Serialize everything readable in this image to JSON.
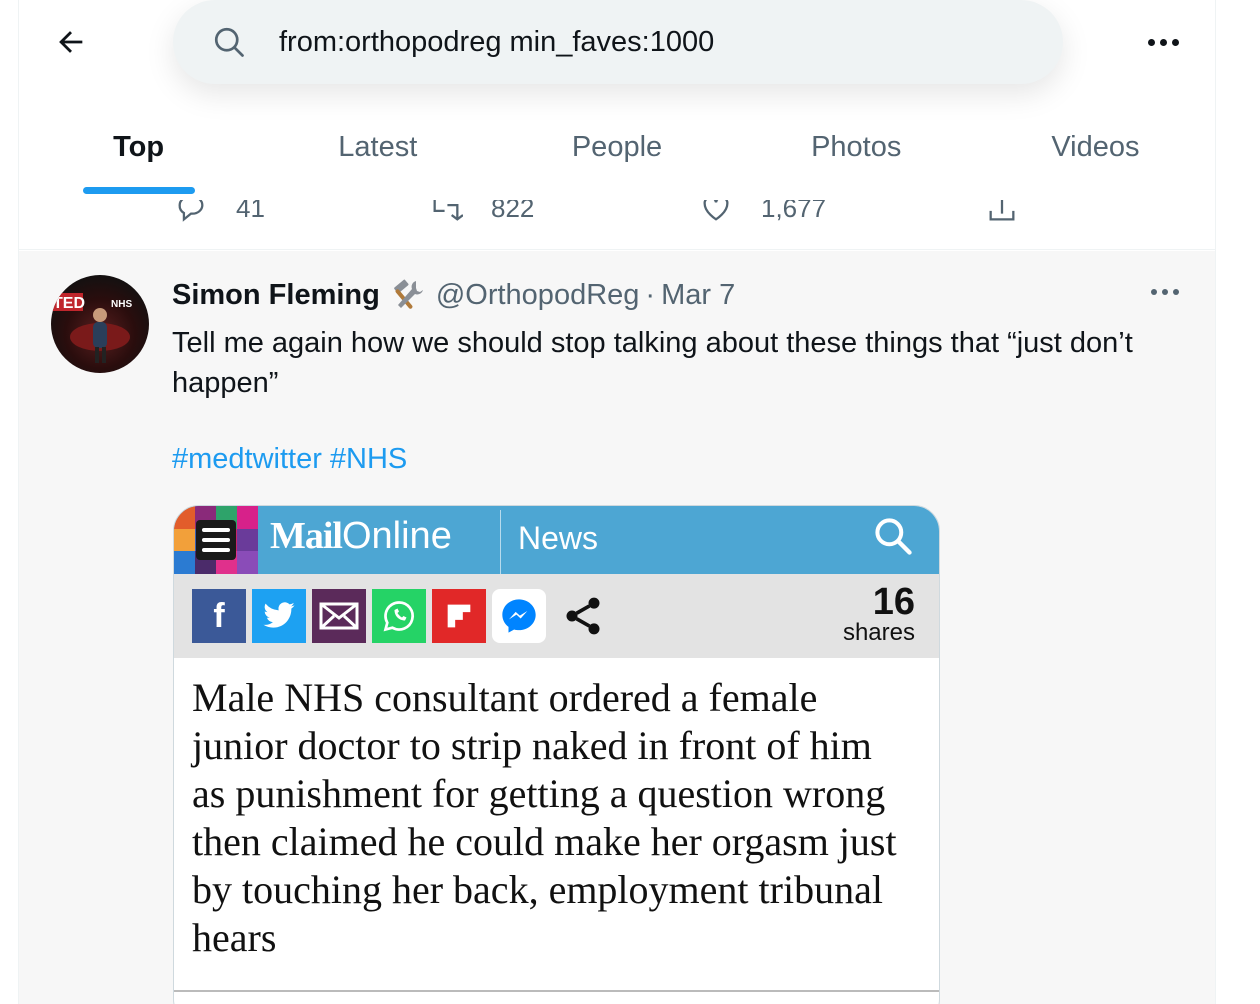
{
  "search": {
    "query": "from:orthopodreg min_faves:1000"
  },
  "tabs": [
    {
      "label": "Top"
    },
    {
      "label": "Latest"
    },
    {
      "label": "People"
    },
    {
      "label": "Photos"
    },
    {
      "label": "Videos"
    }
  ],
  "prev_tweet": {
    "replies": "41",
    "retweets": "822",
    "likes": "1,677"
  },
  "tweet": {
    "display_name": "Simon Fleming",
    "handle": "@OrthopodReg",
    "separator": "·",
    "date": "Mar 7",
    "text": "Tell me again how we should stop talking about these things that “just don’t happen”",
    "hashtags": [
      "#medtwitter",
      "#NHS"
    ]
  },
  "media": {
    "brand_main": "Mail",
    "brand_suffix": "Online",
    "section": "News",
    "shares_count": "16",
    "shares_label": "shares",
    "headline": "Male NHS consultant ordered a female junior doctor to strip naked in front of him as punishment for getting a question wrong then claimed he could make her orgasm just by touching her back, employment tribunal hears",
    "avatar_text": "NHS",
    "avatar_brand": "TED"
  },
  "colors": {
    "accent": "#1d9bf0",
    "mail_blue": "#4da6d3",
    "facebook": "#3b5998",
    "twitter": "#1da1f2",
    "email": "#5b2a5a",
    "whatsapp": "#25d366",
    "flipboard": "#e12828",
    "messenger": "#0084ff"
  }
}
